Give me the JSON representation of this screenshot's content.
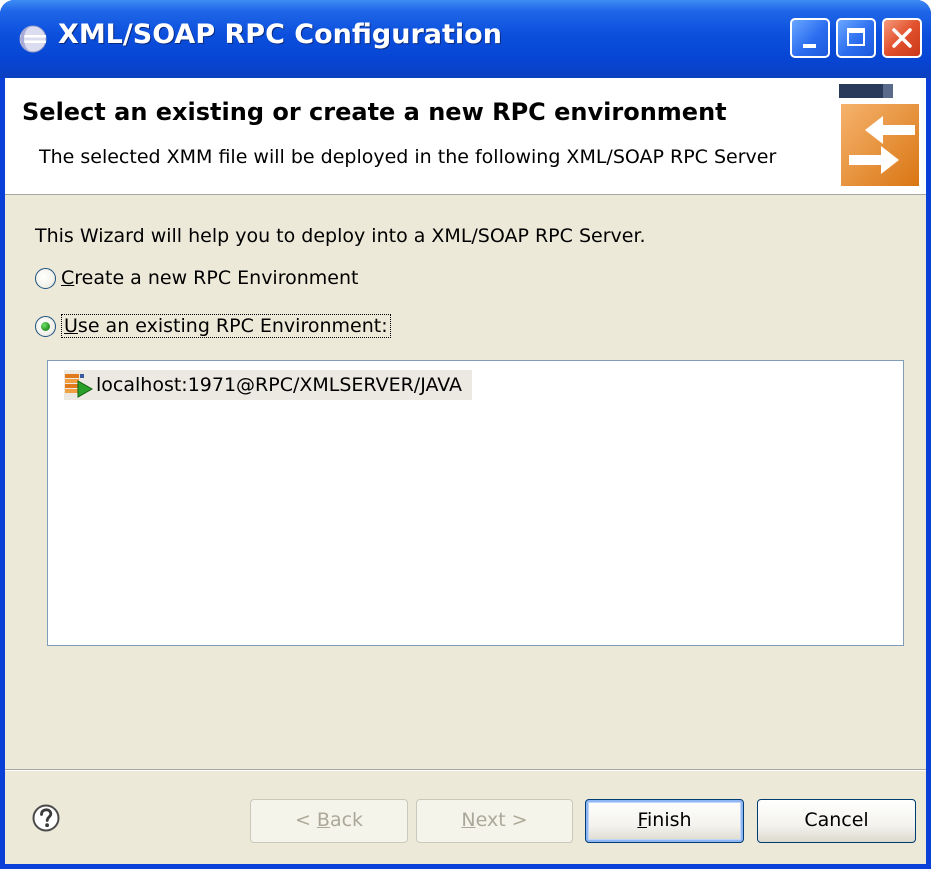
{
  "window": {
    "title": "XML/SOAP RPC Configuration"
  },
  "header": {
    "title": "Select an existing or create a new RPC environment",
    "description": "The selected XMM file will be deployed in the following XML/SOAP RPC Server"
  },
  "body": {
    "intro": "This Wizard will help you to deploy into a XML/SOAP RPC Server.",
    "options": [
      {
        "label_mnemonic": "C",
        "label_rest": "reate a new RPC Environment",
        "checked": false
      },
      {
        "label_mnemonic": "U",
        "label_rest": "se an existing RPC Environment:",
        "checked": true
      }
    ],
    "environments": [
      {
        "label": "localhost:1971@RPC/XMLSERVER/JAVA"
      }
    ]
  },
  "buttons": {
    "back": {
      "prefix": "< ",
      "mnemonic": "B",
      "rest": "ack"
    },
    "next": {
      "mnemonic": "N",
      "rest": "ext >"
    },
    "finish": {
      "mnemonic": "F",
      "rest": "inish"
    },
    "cancel": {
      "label": "Cancel"
    }
  },
  "icons": {
    "title": "eclipse-icon",
    "banner": "wizard-banner-arrows-icon",
    "environment": "rpc-environment-icon",
    "help": "help-icon"
  }
}
